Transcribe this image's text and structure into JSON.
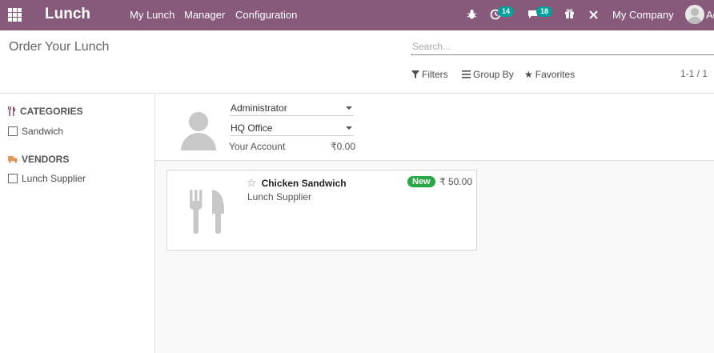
{
  "navbar": {
    "brand": "Lunch",
    "menus": [
      "My Lunch",
      "Manager",
      "Configuration"
    ],
    "activity_badge": "14",
    "messages_badge": "18",
    "company": "My Company",
    "user_truncated": "Ad"
  },
  "control_panel": {
    "title": "Order Your Lunch",
    "search_placeholder": "Search...",
    "filters_label": "Filters",
    "groupby_label": "Group By",
    "favorites_label": "Favorites",
    "pager": "1-1 / 1"
  },
  "sidebar": {
    "categories_title": "CATEGORIES",
    "categories": [
      "Sandwich"
    ],
    "vendors_title": "VENDORS",
    "vendors": [
      "Lunch Supplier"
    ]
  },
  "user_box": {
    "user": "Administrator",
    "location": "HQ Office",
    "account_label": "Your Account",
    "account_value": "₹0.00"
  },
  "products": [
    {
      "name": "Chicken Sandwich",
      "vendor": "Lunch Supplier",
      "badge": "New",
      "price": "₹ 50.00"
    }
  ],
  "colors": {
    "navbar": "#875a7b",
    "badge": "#00a09d",
    "new_badge": "#28a745"
  }
}
